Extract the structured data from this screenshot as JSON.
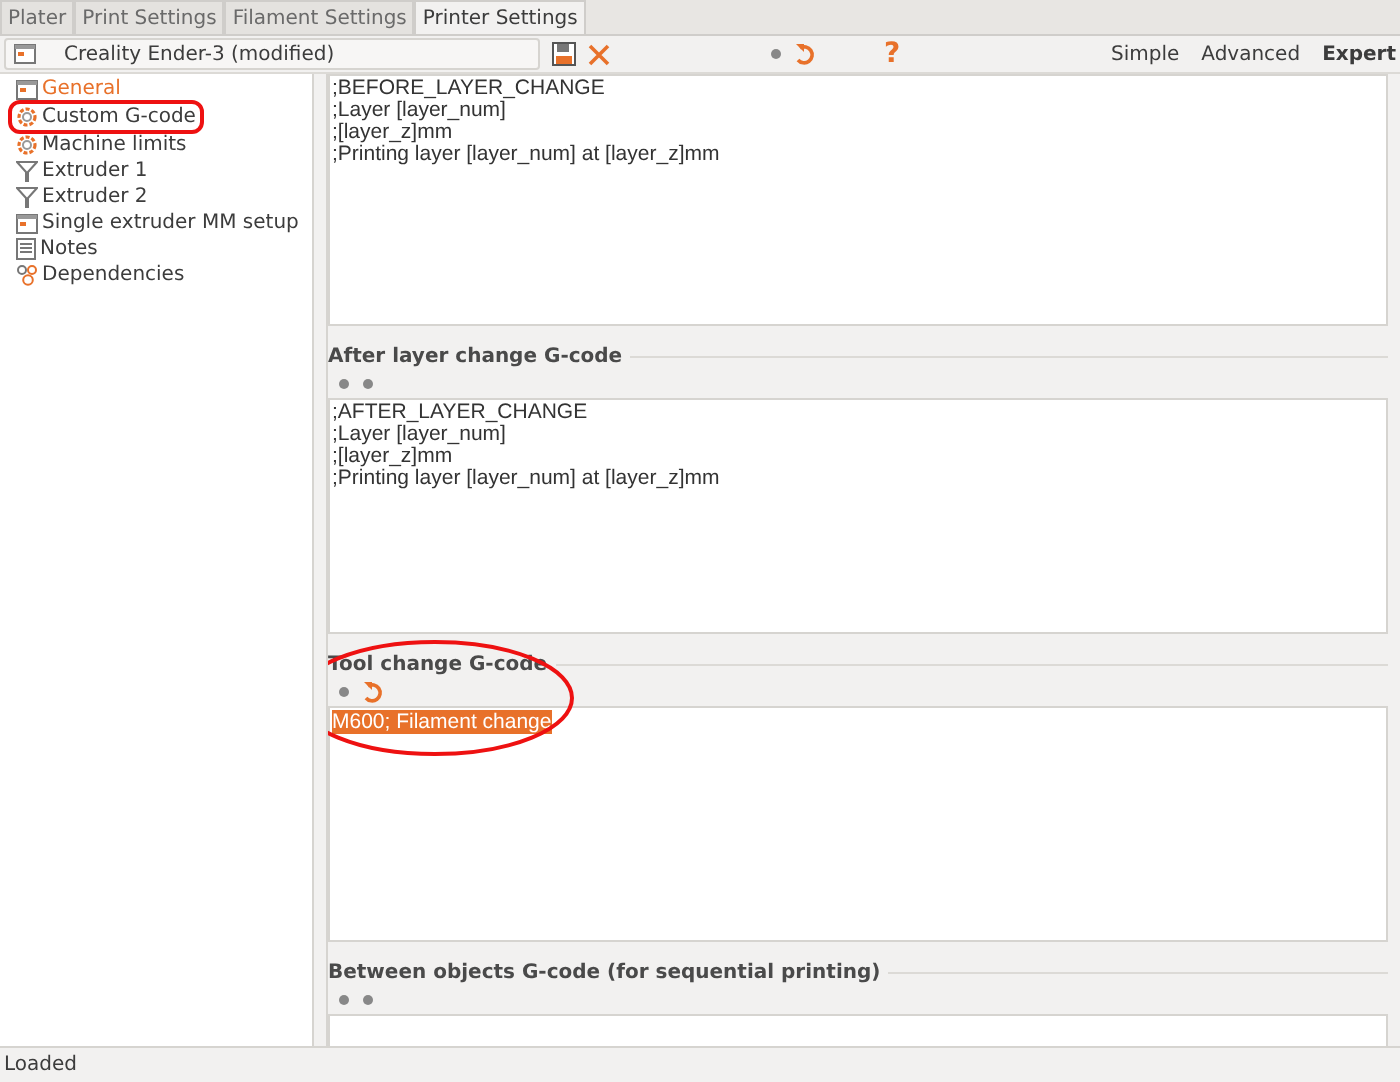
{
  "tabs": [
    {
      "label": "Plater",
      "selected": false
    },
    {
      "label": "Print Settings",
      "selected": false
    },
    {
      "label": "Filament Settings",
      "selected": false
    },
    {
      "label": "Printer Settings",
      "selected": true
    }
  ],
  "toolbar": {
    "preset": "Creality Ender-3 (modified)",
    "modified": true,
    "help": "?",
    "modes": [
      {
        "label": "Simple",
        "selected": false
      },
      {
        "label": "Advanced",
        "selected": false
      },
      {
        "label": "Expert",
        "selected": true
      }
    ]
  },
  "tree": [
    {
      "label": "General",
      "kind": "page",
      "selected": true,
      "circled": false
    },
    {
      "label": "Custom G-code",
      "kind": "gear",
      "selected": false,
      "circled": true
    },
    {
      "label": "Machine limits",
      "kind": "gear",
      "selected": false,
      "circled": false
    },
    {
      "label": "Extruder 1",
      "kind": "funnel",
      "selected": false,
      "circled": false
    },
    {
      "label": "Extruder 2",
      "kind": "funnel",
      "selected": false,
      "circled": false
    },
    {
      "label": "Single extruder MM setup",
      "kind": "page",
      "selected": false,
      "circled": false
    },
    {
      "label": "Notes",
      "kind": "notes",
      "selected": false,
      "circled": false
    },
    {
      "label": "Dependencies",
      "kind": "cluster",
      "selected": false,
      "circled": false
    }
  ],
  "sections": [
    {
      "lines": [
        ";BEFORE_LAYER_CHANGE",
        ";Layer [layer_num]",
        ";[layer_z]mm",
        ";Printing layer [layer_num] at [layer_z]mm"
      ]
    },
    {
      "label": "After layer change G-code",
      "modified": false,
      "circled": false,
      "lines": [
        ";AFTER_LAYER_CHANGE",
        ";Layer [layer_num]",
        ";[layer_z]mm",
        ";Printing layer [layer_num] at [layer_z]mm"
      ]
    },
    {
      "label": "Tool change G-code",
      "modified": true,
      "circled": true,
      "selected_text": "M600; Filament change"
    },
    {
      "label": "Between objects G-code (for sequential printing)",
      "modified": false,
      "circled": false
    }
  ],
  "status_bar": "Loaded"
}
